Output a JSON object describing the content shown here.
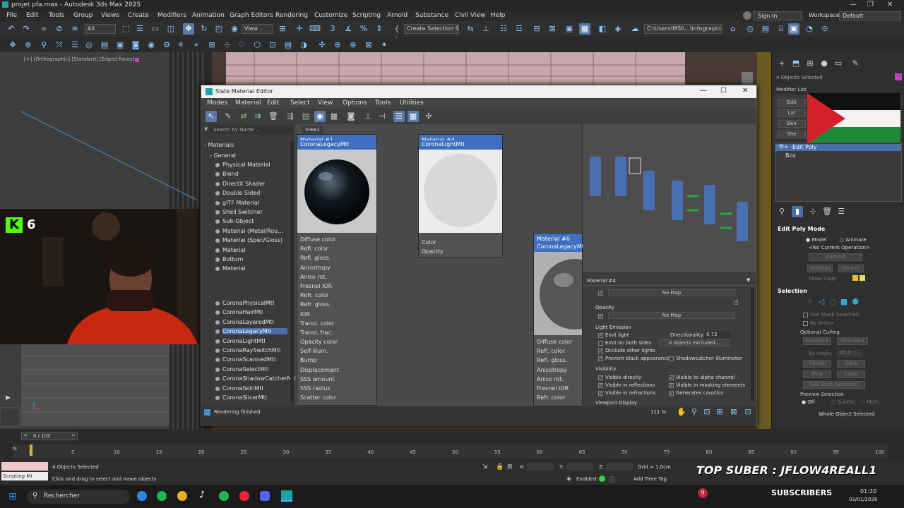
{
  "app": {
    "title": "projet pfa.max - Autodesk 3ds Max 2025"
  },
  "menu": [
    "File",
    "Edit",
    "Tools",
    "Group",
    "Views",
    "Create",
    "Modifiers",
    "Animation",
    "Graph Editors",
    "Rendering",
    "Customize",
    "Scripting",
    "Arnold",
    "Substance",
    "Civil View",
    "Help"
  ],
  "menu_right": {
    "sign_in": "Sign In",
    "workspaces_label": "Workspaces:",
    "workspaces_value": "Default"
  },
  "toolbar": {
    "filter": "All",
    "view": "View",
    "selection_set": "Create Selection Se",
    "path": "C:\\Users\\MSI\\...\\infographie"
  },
  "viewport": {
    "label": "[+] [Orthographic] [Standard] [Edged Faces]"
  },
  "sme": {
    "title": "Slate Material Editor",
    "menu": [
      "Modes",
      "Material",
      "Edit",
      "Select",
      "View",
      "Options",
      "Tools",
      "Utilities"
    ],
    "search_placeholder": "Search by Name ...",
    "view_tab": "View1",
    "browser": {
      "materials": "Materials",
      "general": "General",
      "general_items": [
        "Physical Material",
        "Blend",
        "DirectX Shader",
        "Double Sided",
        "glTF Material",
        "Shell Switcher",
        "Sub-Object",
        "Material (Metal/Rou...",
        "Material (Spec/Gloss)",
        "Material",
        "Bottom",
        "Material"
      ],
      "corona_items": [
        "CoronaPhysicalMtl",
        "CoronaHairMtl",
        "CoronaLayeredMtl",
        "CoronaLegacyMtl",
        "CoronaLightMtl",
        "CoronaRaySwitchMtl",
        "CoronaScannedMtl",
        "CoronaSelectMtl",
        "CoronaShadowCatcherMtl",
        "CoronaSkinMtl",
        "CoronaSlicerMtl"
      ]
    },
    "nodes": {
      "node1": {
        "name": "Material #1",
        "type": "CoronaLegacyMtl",
        "slots": [
          "Diffuse color",
          "Refl. color",
          "Refl. gloss.",
          "Anisotropy",
          "Aniso rot.",
          "Fresnel IOR",
          "Refr. color",
          "Refr. gloss.",
          "IOR",
          "Transl. color",
          "Transl. frac.",
          "Opacity color",
          "Self-illum.",
          "Bump",
          "Displacement",
          "SSS amount",
          "SSS radius",
          "Scatter color"
        ]
      },
      "node2": {
        "name": "Material #4",
        "type": "CoronaLightMtl",
        "slots": [
          "Color",
          "Opacity"
        ]
      },
      "node3": {
        "name": "Material #6",
        "type": "CoronaLegacyMtl",
        "slots": [
          "Diffuse color",
          "Refl. color",
          "Refl. gloss.",
          "Anisotropy",
          "Aniso rot.",
          "Fresnel IOR",
          "Refr. color"
        ]
      }
    },
    "prop": {
      "header": "Material #4",
      "no_map": "No Map",
      "opacity": "Opacity",
      "no_map2": "No Map",
      "light_emission": "Light Emission",
      "emit_light": "Emit light",
      "directionality_label": "Directionality:",
      "directionality_value": "0,72",
      "emit_both": "Emit on both sides",
      "excluded": "0 objects excluded...",
      "occlude": "Occlude other lights",
      "prevent_black": "Prevent black appearance",
      "shadowcatcher": "Shadowcatcher illuminator",
      "visibility": "Visibility",
      "vis_directly": "Visible directly",
      "vis_alpha": "Visible to alpha channel",
      "vis_reflections": "Visible in reflections",
      "vis_masking": "Visible in masking elements",
      "vis_refractions": "Visible in refractions",
      "generates_caustics": "Generates caustics",
      "viewport_display": "Viewport Display"
    },
    "status": "Rendering finished",
    "zoom": "111 %"
  },
  "cmd": {
    "selected": "4 Objects Selected",
    "modifier_list": "Modifier List",
    "stack": [
      "Edit Poly",
      "Box"
    ],
    "edit_poly_mode": "Edit Poly Mode",
    "model": "Model",
    "animate": "Animate",
    "no_op": "<No Current Operation>",
    "commit": "Commit",
    "settings": "Settings",
    "cancel": "Cancel",
    "show_cage": "Show Cage",
    "selection": "Selection",
    "use_stack": "Use Stack Selection",
    "by_vertex": "By Vertex",
    "ignore_culling": "Optional Culling",
    "backface": "Backface",
    "occluded": "Occluded",
    "by_angle": "By Angle:",
    "angle_val": "45,0",
    "shrink": "Shrink",
    "grow": "Grow",
    "ring": "Ring",
    "loop": "Loop",
    "get_stack": "Get Stack Selection",
    "preview_selection": "Preview Selection",
    "off": "Off",
    "subobj": "SubObj",
    "multi": "Multi",
    "whole_object": "Whole Object Selected",
    "stack_hidden": [
      "Edit",
      "Lat",
      "Ben",
      "She"
    ]
  },
  "timeline": {
    "frame": "0 / 100",
    "ticks": [
      "0",
      "5",
      "10",
      "15",
      "20",
      "25",
      "30",
      "35",
      "40",
      "45",
      "50",
      "55",
      "60",
      "65",
      "70",
      "75",
      "80",
      "85",
      "90",
      "95",
      "100"
    ]
  },
  "status": {
    "selected": "4 Objects Selected",
    "hint": "Click and drag to select and move objects",
    "x": "X:",
    "y": "Y:",
    "z": "Z:",
    "grid": "Grid = 1,0cm",
    "enabled": "Enabled:",
    "add_time_tag": "Add Time Tag",
    "script": "Scripting Mi",
    "overlay_text": "TOP SUBER : JFLOW4REALL1",
    "subscribers": "SUBSCRIBERS",
    "sub_count": "9"
  },
  "taskbar": {
    "search": "Rechercher",
    "time": "01:20",
    "date": "03/01/2026"
  },
  "overlay": {
    "kick_count": "6"
  }
}
